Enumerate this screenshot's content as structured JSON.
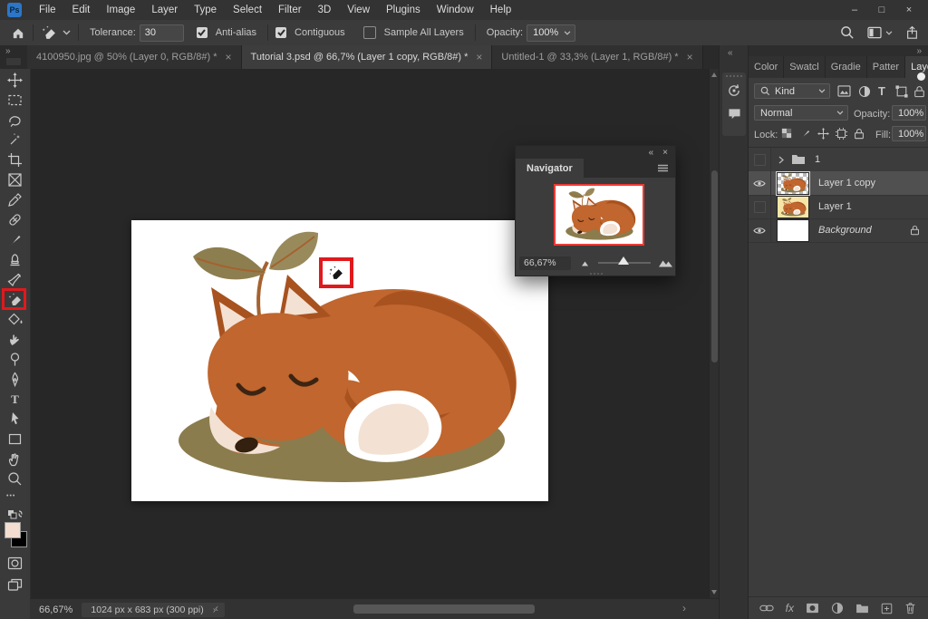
{
  "ui": {
    "close_glyph": "×",
    "collapse_glyph": "«",
    "expand_glyph": "»",
    "ellipsis": "•••",
    "doc_chevron": "›",
    "scroll_left": "‹",
    "scroll_right": "›",
    "fx": "fx",
    "type_glyph": "T"
  },
  "window": {
    "minimize": "–",
    "maximize": "□",
    "close": "×"
  },
  "menu_bar": {
    "logo": "Ps",
    "items": [
      "File",
      "Edit",
      "Image",
      "Layer",
      "Type",
      "Select",
      "Filter",
      "3D",
      "View",
      "Plugins",
      "Window",
      "Help"
    ]
  },
  "options_bar": {
    "tool": "magic-eraser",
    "tolerance_label": "Tolerance:",
    "tolerance_value": "30",
    "anti_alias_label": "Anti-alias",
    "anti_alias_checked": true,
    "contiguous_label": "Contiguous",
    "contiguous_checked": true,
    "sample_all_layers_label": "Sample All Layers",
    "sample_all_layers_checked": false,
    "opacity_label": "Opacity:",
    "opacity_value": "100%"
  },
  "document_tabs": {
    "tabs": [
      {
        "label": "4100950.jpg @ 50% (Layer 0, RGB/8#) *",
        "active": false
      },
      {
        "label": "Tutorial 3.psd @ 66,7% (Layer 1 copy, RGB/8#) *",
        "active": true
      },
      {
        "label": "Untitled-1 @ 33,3% (Layer 1, RGB/8#) *",
        "active": false
      }
    ]
  },
  "tool_bar": {
    "tools": [
      "move",
      "rectangular-marquee",
      "lasso",
      "magic-wand",
      "crop",
      "frame",
      "eyedropper",
      "spot-healing-brush",
      "brush",
      "clone-stamp",
      "history-brush",
      "magic-eraser",
      "paint-bucket",
      "smudge",
      "dodge",
      "pen",
      "type",
      "path-selection",
      "rectangle",
      "hand",
      "zoom"
    ],
    "selected_tool": "magic-eraser",
    "foreground_color": "#f2ddd0",
    "background_color": "#000000"
  },
  "navigator": {
    "title": "Navigator",
    "zoom_value": "66,67%"
  },
  "right_panel": {
    "tabs": [
      "Color",
      "Swatcl",
      "Gradie",
      "Patter",
      "Layers"
    ],
    "active_tab": "Layers",
    "filter_kind": "Kind",
    "blend_mode": "Normal",
    "opacity_label": "Opacity:",
    "opacity_value": "100%",
    "lock_label": "Lock:",
    "fill_label": "Fill:",
    "fill_value": "100%",
    "layers": [
      {
        "kind": "group",
        "name": "1",
        "visible": false,
        "selected": false
      },
      {
        "kind": "layer",
        "name": "Layer 1 copy",
        "visible": true,
        "selected": true
      },
      {
        "kind": "layer",
        "name": "Layer 1",
        "visible": false,
        "selected": false
      },
      {
        "kind": "background",
        "name": "Background",
        "visible": true,
        "locked": true,
        "selected": false
      }
    ]
  },
  "status_bar": {
    "zoom": "66,67%",
    "doc_info": "1024 px x 683 px (300 ppi)"
  },
  "colors": {
    "accent_red": "#e0191d",
    "panel_bg": "#3c3c3c",
    "pasteboard": "#272727",
    "fox_body": "#c0662e",
    "fox_shadow": "#a8521f",
    "fox_cream": "#f3e1d3",
    "fox_white": "#ffffff",
    "ground": "#8b7c4e",
    "leaf_dark": "#8d7e4f",
    "leaf_light": "#998a5c",
    "stem": "#a5622f",
    "nose": "#33200f",
    "layer1_thumb_bg": "#f6e5a6",
    "foreground_swatch": "#f2ddd0"
  }
}
